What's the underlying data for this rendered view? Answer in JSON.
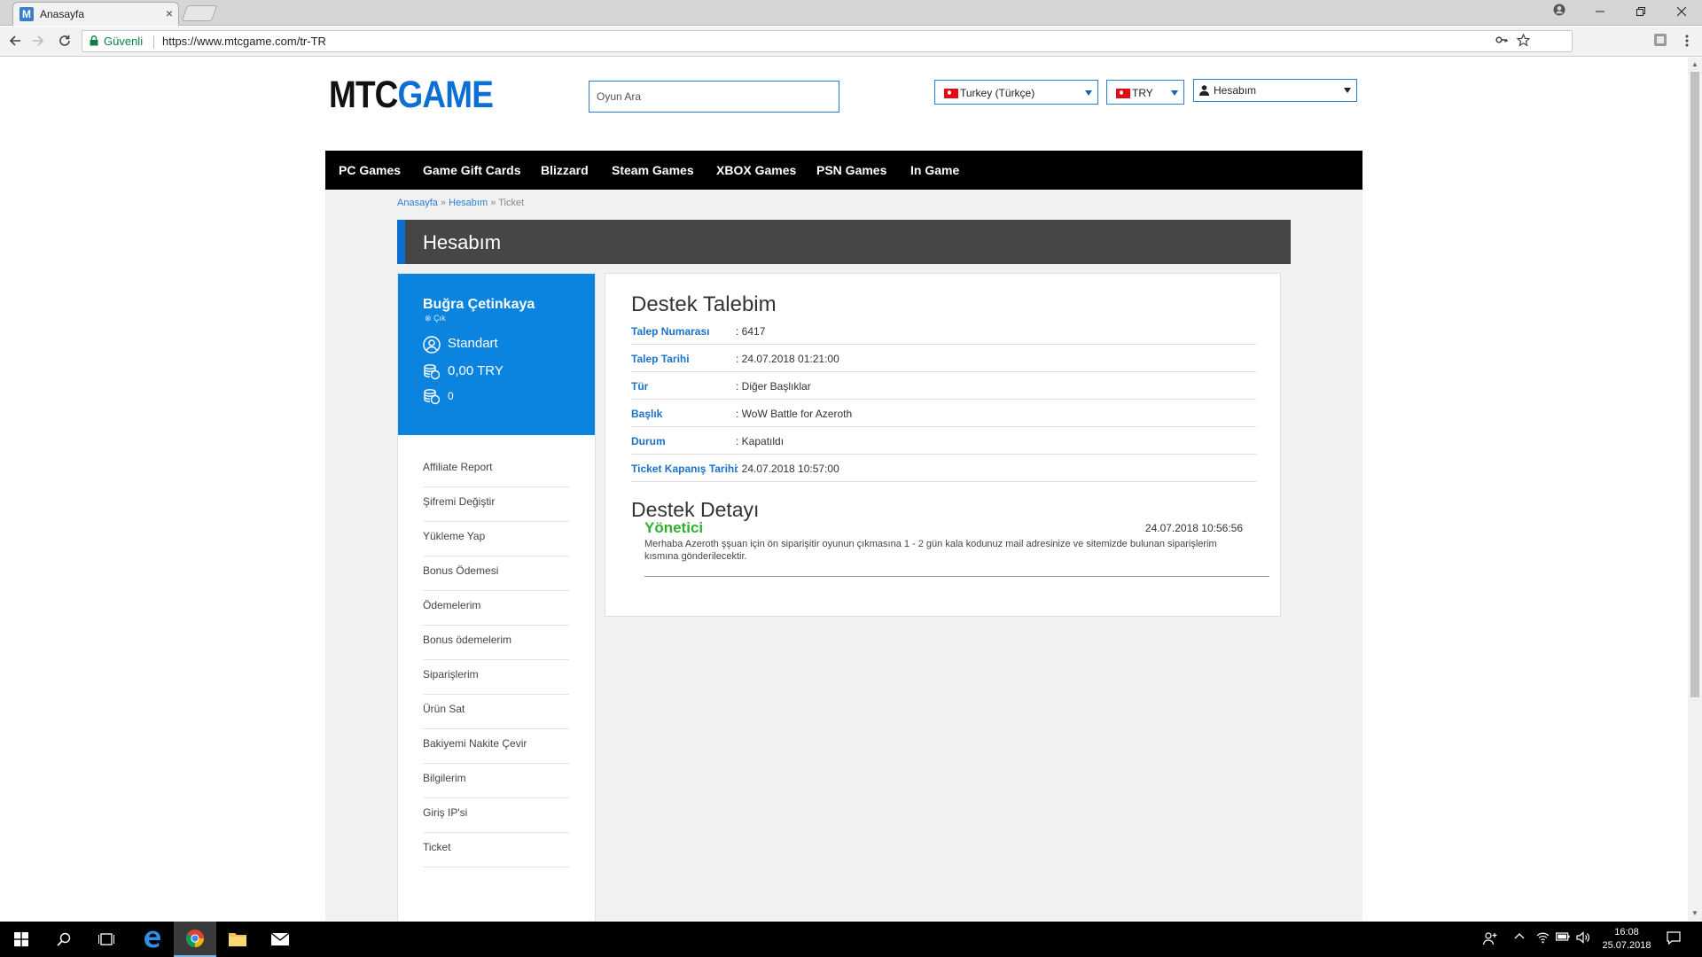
{
  "browser": {
    "tab_title": "Anasayfa",
    "tab_close": "×",
    "secure_label": "Güvenli",
    "url": "https://www.mtcgame.com/tr-TR"
  },
  "site": {
    "logo_part1": "MTC",
    "logo_part2": "GAME",
    "search_placeholder": "Oyun Ara",
    "language": "Turkey (Türkçe)",
    "currency": "TRY",
    "account": "Hesabım",
    "nav": [
      "PC Games",
      "Game Gift Cards",
      "Blizzard",
      "Steam Games",
      "XBOX Games",
      "PSN Games",
      "In Game"
    ]
  },
  "breadcrumb": {
    "home": "Anasayfa",
    "sep": "»",
    "account": "Hesabım",
    "current": "Ticket"
  },
  "page_title": "Hesabım",
  "profile": {
    "name": "Buğra Çetinkaya",
    "logout": "Çık",
    "membership": "Standart",
    "balance": "0,00 TRY",
    "bonus": "0"
  },
  "menu": [
    "Affiliate Report",
    "Şifremi Değiştir",
    "Yükleme Yap",
    "Bonus Ödemesi",
    "Ödemelerim",
    "Bonus ödemelerim",
    "Siparişlerim",
    "Ürün Sat",
    "Bakiyemi Nakite Çevir",
    "Bilgilerim",
    "Giriş IP'si",
    "Ticket"
  ],
  "ticket": {
    "heading": "Destek Talebim",
    "rows": [
      {
        "label": "Talep Numarası",
        "value": ": 6417"
      },
      {
        "label": "Talep Tarihi",
        "value": ": 24.07.2018 01:21:00"
      },
      {
        "label": "Tür",
        "value": ": Diğer Başlıklar"
      },
      {
        "label": "Başlık",
        "value": ": WoW Battle for Azeroth"
      },
      {
        "label": "Durum",
        "value": ": Kapatıldı"
      },
      {
        "label": "Ticket Kapanış Tarihi",
        "value": ": 24.07.2018 10:57:00"
      }
    ],
    "detail_heading": "Destek Detayı",
    "message": {
      "author": "Yönetici",
      "date": "24.07.2018 10:56:56",
      "text": "Merhaba Azeroth şşuan için ön siparişitir oyunun çıkmasına 1 - 2 gün kala kodunuz mail adresinize ve sitemizde bulunan siparişlerim kısmına gönderilecektir."
    }
  },
  "taskbar": {
    "time": "16:08",
    "date": "25.07.2018"
  },
  "colors": {
    "brand_blue": "#0b84e0",
    "nav_black": "#000000",
    "link_blue": "#1a73c9",
    "author_green": "#2fb02f"
  }
}
